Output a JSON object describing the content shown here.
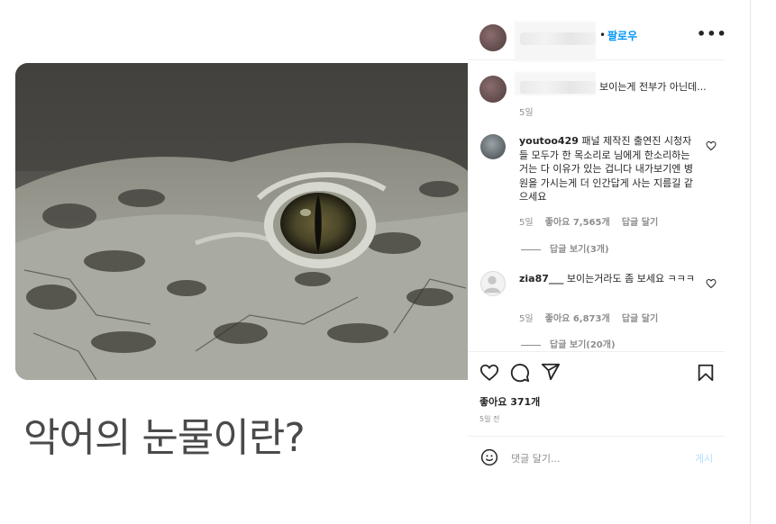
{
  "post": {
    "overlay_text": "악어의 눈물이란?"
  },
  "header": {
    "dot": "•",
    "follow_label": "팔로우",
    "more_label": "•••"
  },
  "caption": {
    "text": "보이는게 전부가 아닌데...",
    "time": "5일"
  },
  "comments": [
    {
      "username": "youtoo429",
      "text": "패널 제작진 출연진 시청자들 모두가 한 목소리로 님에게 한소리하는거는 다 이유가 있는 겁니다 내가보기엔 병원을 가시는게 더 인간답게 사는 지름길 같으세요",
      "time": "5일",
      "likes": "좋아요 7,565개",
      "reply": "답글 달기",
      "view_replies": "답글 보기(3개)"
    },
    {
      "username": "zia87___",
      "text": "보이는거라도 좀 보세요 ㅋㅋㅋ",
      "time": "5일",
      "likes": "좋아요 6,873개",
      "reply": "답글 달기",
      "view_replies": "답글 보기(20개)"
    }
  ],
  "actions": {
    "icons": [
      "heart-icon",
      "comment-icon",
      "share-icon",
      "bookmark-icon"
    ],
    "likes": "좋아요 371개",
    "time": "5일 전"
  },
  "comment_input": {
    "placeholder": "댓글 달기...",
    "post_label": "게시"
  },
  "colors": {
    "link": "#0095f6",
    "muted": "#8e8e8e",
    "text": "#262626",
    "post_disabled": "#b2dffc"
  }
}
